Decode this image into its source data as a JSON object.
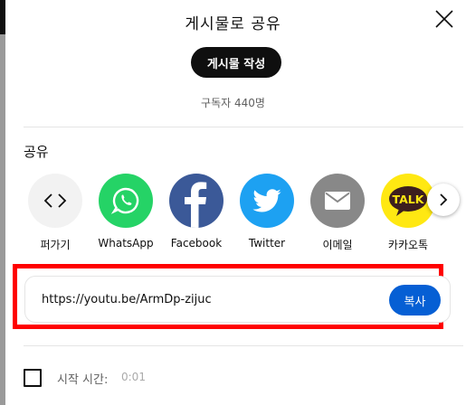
{
  "dialog": {
    "title": "게시물로 공유",
    "post_button": "게시물 작성",
    "subscribers": "구독자 440명"
  },
  "share": {
    "heading": "공유",
    "items": [
      {
        "label": "퍼가기",
        "icon": "embed-icon",
        "bg": "#f2f2f2"
      },
      {
        "label": "WhatsApp",
        "icon": "whatsapp-icon",
        "bg": "#25d366"
      },
      {
        "label": "Facebook",
        "icon": "facebook-icon",
        "bg": "#3b5998"
      },
      {
        "label": "Twitter",
        "icon": "twitter-icon",
        "bg": "#1da1f2"
      },
      {
        "label": "이메일",
        "icon": "email-icon",
        "bg": "#888888"
      },
      {
        "label": "카카오톡",
        "icon": "kakaotalk-icon",
        "bg": "#ffe812",
        "icon_text": "TALK"
      }
    ],
    "next_icon": "chevron-right-icon"
  },
  "link": {
    "url": "https://youtu.be/ArmDp-zijuc",
    "copy_label": "복사",
    "highlight_color": "#ff0000",
    "accent": "#065fd4"
  },
  "start": {
    "label": "시작 시간:",
    "time": "0:01",
    "checked": false
  }
}
